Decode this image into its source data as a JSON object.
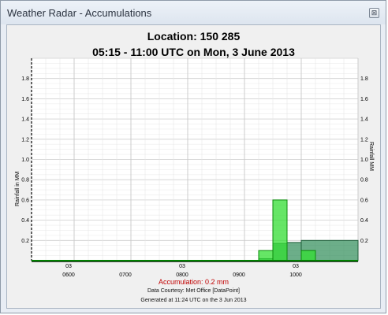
{
  "window": {
    "title": "Weather Radar - Accumulations",
    "close_glyph": "⊠"
  },
  "header": {
    "location": "Location: 150 285",
    "period": "05:15 - 11:00 UTC on Mon, 3 June 2013"
  },
  "footer": {
    "accumulation": "Accumulation: 0.2 mm",
    "courtesy": "Data Courtesy: Met Office [DataPoint]",
    "generated": "Generated at 11:24 UTC on the 3 Jun 2013"
  },
  "chart_data": {
    "type": "bar",
    "ylabel_left": "Rainfall in MM",
    "ylabel_right": "Rainfall MM",
    "ylim": [
      0,
      2.0
    ],
    "y_ticks": [
      "0.2",
      "0.4",
      "0.6",
      "0.8",
      "1.0",
      "1.2",
      "1.4",
      "1.6",
      "1.8"
    ],
    "x_range_hours": [
      5.25,
      11.0
    ],
    "x_major_labels": [
      {
        "hour": 6,
        "top": "03",
        "bottom": "0600"
      },
      {
        "hour": 7,
        "top": "",
        "bottom": "0700"
      },
      {
        "hour": 8,
        "top": "03",
        "bottom": "0800"
      },
      {
        "hour": 9,
        "top": "",
        "bottom": "0900"
      },
      {
        "hour": 10,
        "top": "03",
        "bottom": "1000"
      }
    ],
    "grid": true,
    "series": [
      {
        "name": "",
        "kind": "rate-bars",
        "color": "#33dd33",
        "bars": [
          {
            "start": 9.25,
            "end": 9.5,
            "value": 0.1
          },
          {
            "start": 9.5,
            "end": 9.75,
            "value": 0.6
          },
          {
            "start": 10.0,
            "end": 10.25,
            "value": 0.1
          }
        ]
      },
      {
        "name": "",
        "kind": "accumulation-area",
        "color": "#2e8b57",
        "steps": [
          {
            "start": 9.25,
            "end": 9.5,
            "value": 0.02
          },
          {
            "start": 9.5,
            "end": 9.75,
            "value": 0.17
          },
          {
            "start": 9.75,
            "end": 10.0,
            "value": 0.18
          },
          {
            "start": 10.0,
            "end": 11.0,
            "value": 0.2
          }
        ]
      }
    ]
  }
}
